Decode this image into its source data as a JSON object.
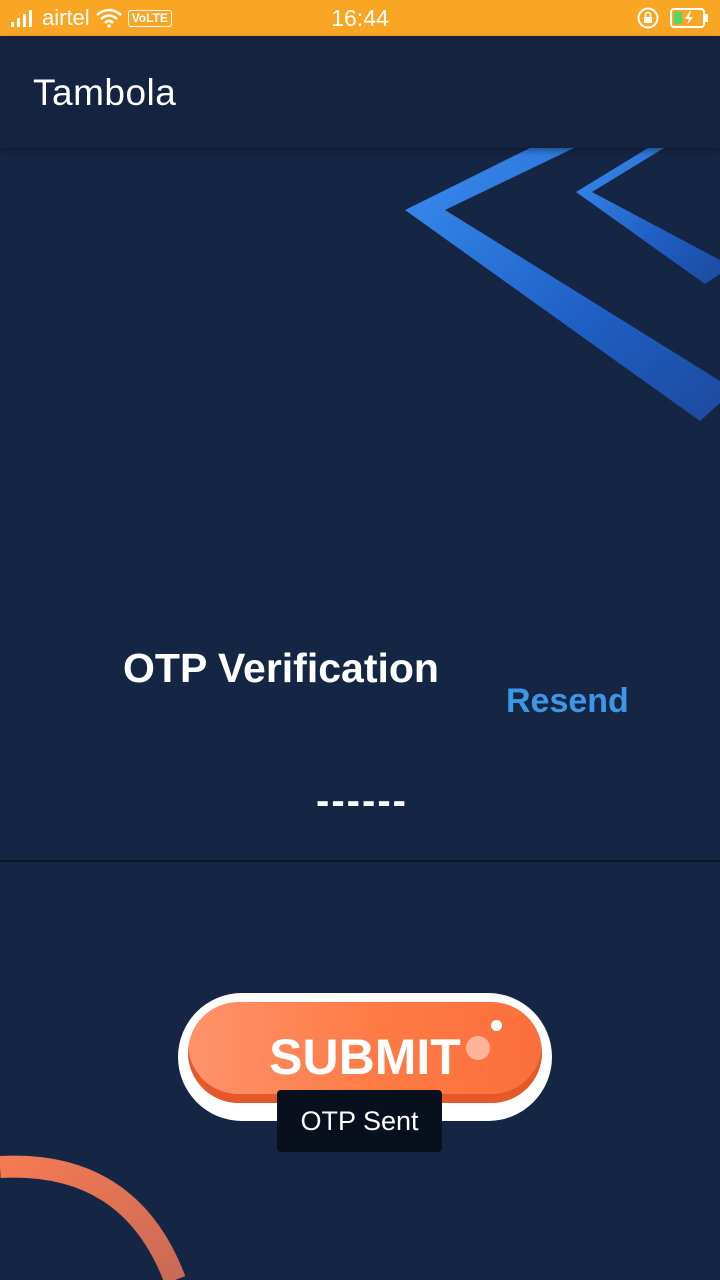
{
  "status_bar": {
    "carrier": "airtel",
    "volte": "VoLTE",
    "time": "16:44",
    "icons": [
      "signal-icon",
      "wifi-icon",
      "rotation-lock-icon",
      "battery-charging-icon"
    ]
  },
  "app_bar": {
    "title": "Tambola"
  },
  "otp": {
    "title": "OTP Verification",
    "resend_label": "Resend",
    "input_value": "",
    "input_placeholder": "------"
  },
  "submit": {
    "label": "SUBMIT"
  },
  "toast": {
    "message": "OTP Sent"
  },
  "colors": {
    "status_bar": "#f8a623",
    "background": "#152644",
    "accent_blue": "#3d97e6",
    "submit_orange": "#ff7a45"
  }
}
